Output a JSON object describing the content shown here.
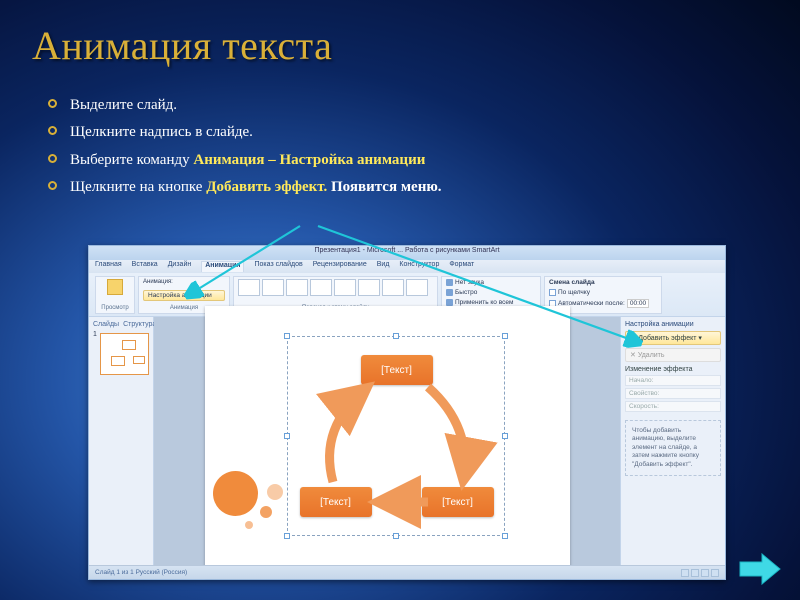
{
  "title": "Анимация текста",
  "bullets": [
    {
      "pre": "Выделите слайд."
    },
    {
      "pre": "Щелкните надпись в слайде."
    },
    {
      "pre": "Выберите команду ",
      "hl": "Анимация – Настройка анимации"
    },
    {
      "pre": "Щелкните на кнопке ",
      "hl": "Добавить эффект.",
      "post": " Появится меню."
    }
  ],
  "screenshot": {
    "window_title": "Презентация1 - Microsoft ...        Работа с рисунками SmartArt",
    "tabs": [
      "Главная",
      "Вставка",
      "Дизайн",
      "Анимация",
      "Показ слайдов",
      "Рецензирование",
      "Вид",
      "Конструктор",
      "Формат"
    ],
    "ribbon": {
      "group_preview": "Просмотр",
      "anim_dropdown": "Анимация:",
      "anim_settings_btn": "Настройка анимации",
      "anim_group_label": "Анимация",
      "transition_label": "Переход к этому слайду",
      "sound_label": "Нет звука",
      "speed_label": "Быстро",
      "apply_all": "Применить ко всем",
      "advance": {
        "heading": "Смена слайда",
        "click": "По щелчку",
        "auto": "Автоматически после:",
        "time": "00:00"
      }
    },
    "thumbs_pane": {
      "tabs": [
        "Слайды",
        "Структура"
      ],
      "slide_number": "1"
    },
    "smartart": {
      "node_label": "[Текст]"
    },
    "task_pane": {
      "title": "Настройка анимации",
      "add_effect": "Добавить эффект",
      "remove": "Удалить",
      "section": "Изменение эффекта",
      "start": "Начало:",
      "property": "Свойство:",
      "speed": "Скорость:",
      "hint": "Чтобы добавить анимацию, выделите элемент на слайде, а затем нажмите кнопку \"Добавить эффект\"."
    },
    "statusbar": {
      "left": "Слайд 1 из 1    Русский (Россия)"
    }
  }
}
